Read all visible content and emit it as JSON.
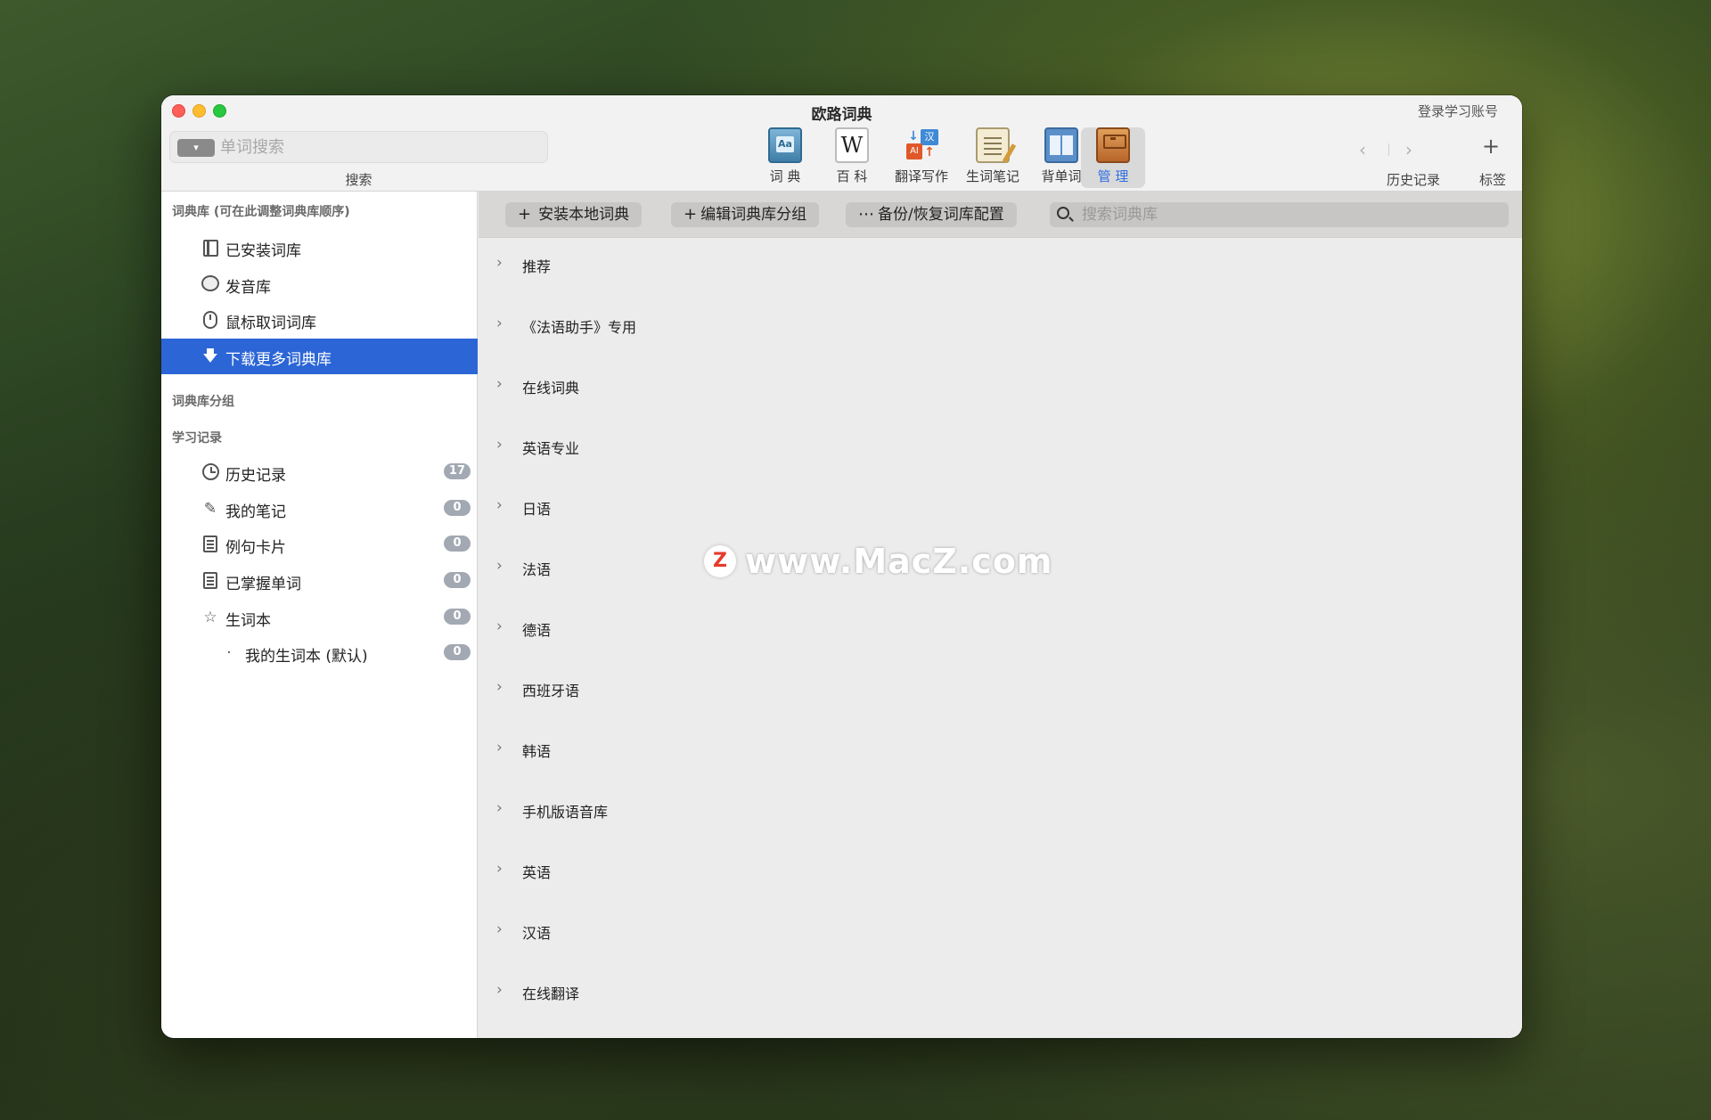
{
  "window": {
    "title": "欧路词典",
    "login_link": "登录学习账号"
  },
  "search": {
    "placeholder": "单词搜索",
    "caption": "搜索",
    "mode_label": "▾"
  },
  "toolbar": {
    "tools": [
      {
        "label": "词 典",
        "icon": "dictionary-icon"
      },
      {
        "label": "百 科",
        "icon": "wiki-icon"
      },
      {
        "label": "翻译写作",
        "icon": "translate-icon"
      },
      {
        "label": "生词笔记",
        "icon": "notes-icon"
      },
      {
        "label": "背单词",
        "icon": "flashcards-icon"
      },
      {
        "label": "管 理",
        "icon": "manage-icon"
      }
    ],
    "active": "管 理",
    "history_caption": "历史记录",
    "tags_caption": "标签",
    "back_glyph": "‹",
    "forward_glyph": "›",
    "plus_glyph": "+"
  },
  "sidebar": {
    "section_libraries": "词典库 (可在此调整词典库顺序)",
    "library_items": [
      {
        "label": "已安装词库",
        "icon": "book-icon"
      },
      {
        "label": "发音库",
        "icon": "speech-bubble-icon"
      },
      {
        "label": "鼠标取词词库",
        "icon": "mouse-icon"
      },
      {
        "label": "下载更多词典库",
        "icon": "download-arrow-icon"
      }
    ],
    "selected_item": "下载更多词典库",
    "section_groups": "词典库分组",
    "section_records": "学习记录",
    "record_items": [
      {
        "label": "历史记录",
        "count": "17",
        "icon": "clock-icon"
      },
      {
        "label": "我的笔记",
        "count": "0",
        "icon": "pencil-icon"
      },
      {
        "label": "例句卡片",
        "count": "0",
        "icon": "card-icon"
      },
      {
        "label": "已掌握单词",
        "count": "0",
        "icon": "mastered-icon"
      },
      {
        "label": "生词本",
        "count": "0",
        "icon": "star-icon"
      }
    ],
    "sub_item": {
      "bullet": "·",
      "label": "我的生词本 (默认)",
      "count": "0"
    }
  },
  "actions": {
    "install_local": "安装本地词典",
    "edit_groups": "编辑词典库分组",
    "backup_restore": "备份/恢复词库配置",
    "search_placeholder": "搜索词典库",
    "plus_glyph": "+",
    "more_glyph": "⋯"
  },
  "groups": [
    "推荐",
    "《法语助手》专用",
    "在线词典",
    "英语专业",
    "日语",
    "法语",
    "德语",
    "西班牙语",
    "韩语",
    "手机版语音库",
    "英语",
    "汉语",
    "在线翻译"
  ],
  "group_chevron": "›",
  "watermark": {
    "logo": "Z",
    "text": "www.MacZ.com"
  }
}
